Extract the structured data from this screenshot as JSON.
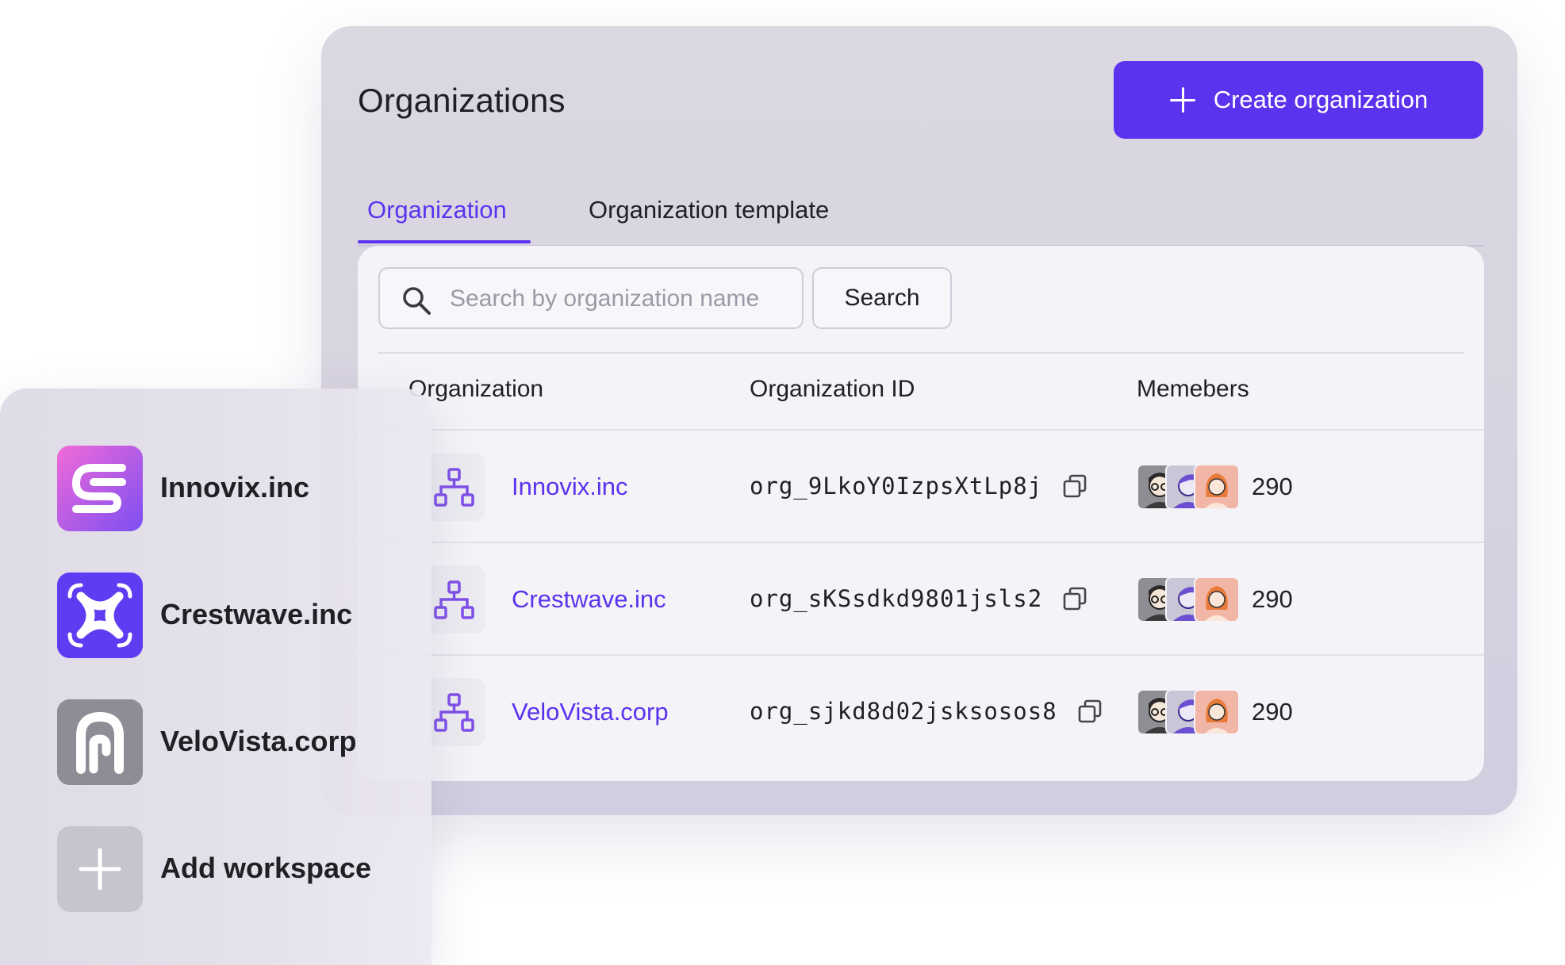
{
  "page": {
    "title": "Organizations",
    "create_button_label": "Create organization",
    "tabs": [
      {
        "label": "Organization",
        "active": true
      },
      {
        "label": "Organization template",
        "active": false
      }
    ]
  },
  "search": {
    "placeholder": "Search by organization name",
    "value": "",
    "button_label": "Search"
  },
  "table": {
    "columns": [
      "Organization",
      "Organization ID",
      "Memebers"
    ],
    "rows": [
      {
        "name": "Innovix.inc",
        "id": "org_9LkoY0IzpsXtLp8j",
        "members": "290"
      },
      {
        "name": "Crestwave.inc",
        "id": "org_sKSsdkd9801jsls2",
        "members": "290"
      },
      {
        "name": "VeloVista.corp",
        "id": "org_sjkd8d02jsksosos8",
        "members": "290"
      }
    ]
  },
  "workspaces": {
    "items": [
      {
        "label": "Innovix.inc",
        "icon": "innovix-logo-icon"
      },
      {
        "label": "Crestwave.inc",
        "icon": "crestwave-logo-icon"
      },
      {
        "label": "VeloVista.corp",
        "icon": "velovista-logo-icon"
      },
      {
        "label": "Add workspace",
        "icon": "plus-icon"
      }
    ]
  },
  "colors": {
    "accent": "#5b33ef",
    "panel_bg": "#d9d5e1",
    "card_bg": "#f4f3f7",
    "text": "#1f1f24"
  }
}
